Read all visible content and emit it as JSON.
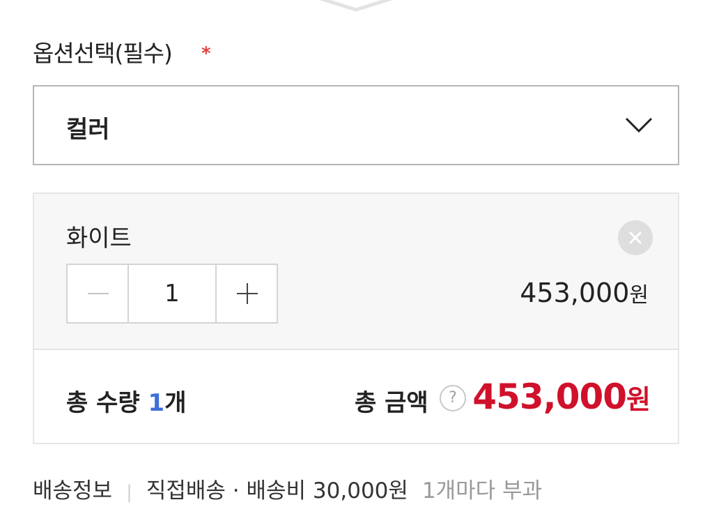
{
  "option_section": {
    "title": "옵션선택(필수)",
    "required_mark": "*"
  },
  "select": {
    "selected_label": "컬러",
    "icon": "chevron-down-icon"
  },
  "selected_item": {
    "name": "화이트",
    "quantity": "1",
    "price_number": "453,000",
    "price_unit": "원",
    "remove_icon": "close-icon"
  },
  "summary": {
    "qty_label": "총 수량 ",
    "qty_count": "1",
    "qty_unit": "개",
    "amount_label": "총 금액",
    "help_symbol": "?",
    "total_number": "453,000",
    "total_unit": "원"
  },
  "delivery": {
    "label": "배송정보",
    "separator": "|",
    "method": "직접배송 · 배송비 30,000원",
    "note": "1개마다 부과"
  },
  "colors": {
    "accent_red": "#d0112b",
    "accent_blue": "#3d6fd8",
    "required_red": "#e04545"
  }
}
